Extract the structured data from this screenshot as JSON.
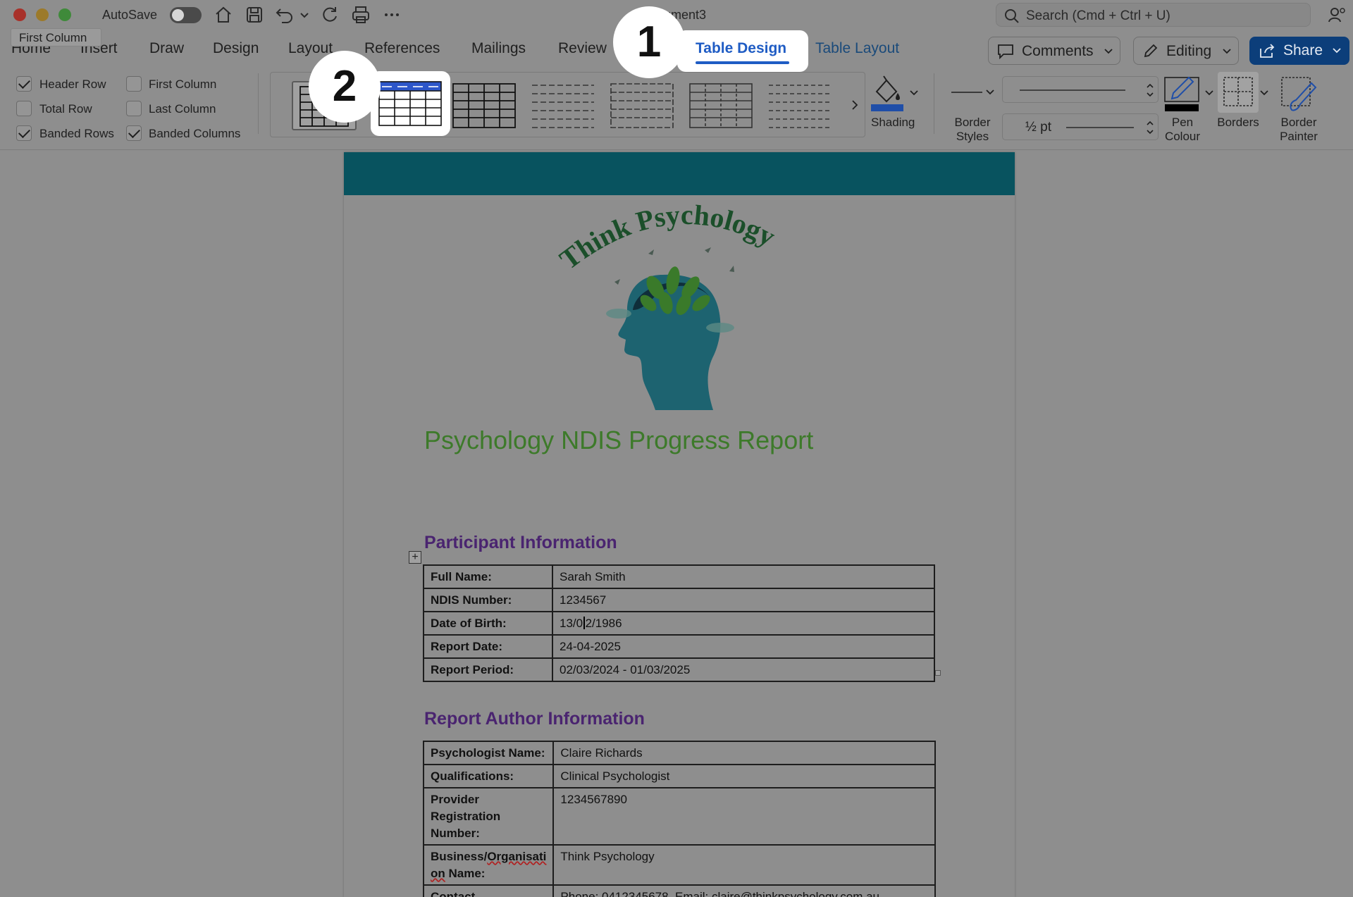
{
  "titlebar": {
    "autosave_label": "AutoSave",
    "doc_title": "Document3",
    "search_placeholder": "Search (Cmd + Ctrl + U)"
  },
  "tooltip": {
    "text": "First Column"
  },
  "tabs": [
    {
      "label": "Home"
    },
    {
      "label": "Insert"
    },
    {
      "label": "Draw"
    },
    {
      "label": "Design"
    },
    {
      "label": "Layout"
    },
    {
      "label": "References"
    },
    {
      "label": "Mailings"
    },
    {
      "label": "Review"
    }
  ],
  "active_tab": {
    "label": "Table Design"
  },
  "table_layout_tab": {
    "label": "Table Layout"
  },
  "actions": {
    "comments": "Comments",
    "editing": "Editing",
    "share": "Share"
  },
  "style_options": [
    {
      "label": "Header Row",
      "checked": true
    },
    {
      "label": "First Column",
      "checked": false
    },
    {
      "label": "Total Row",
      "checked": false
    },
    {
      "label": "Last Column",
      "checked": false
    },
    {
      "label": "Banded Rows",
      "checked": true
    },
    {
      "label": "Banded Columns",
      "checked": true
    }
  ],
  "ribbon": {
    "shading": "Shading",
    "border_styles": "Border Styles",
    "pen_weight": "½ pt",
    "pen_colour": "Pen Colour",
    "borders": "Borders",
    "border_painter": "Border Painter"
  },
  "callouts": {
    "step1": "1",
    "step2": "2"
  },
  "colors": {
    "header_band": "#08535f",
    "title_green": "#3d7a2a",
    "section_purple": "#4a2470",
    "accent_blue": "#1f5cc4",
    "share_blue": "#0c3e7a"
  },
  "document": {
    "logo_text": "Think Psychology",
    "title": "Psychology NDIS Progress Report",
    "participant_heading": "Participant Information",
    "participant_rows": [
      {
        "key": "Full Name:",
        "value": "Sarah Smith"
      },
      {
        "key": "NDIS Number:",
        "value": "1234567"
      },
      {
        "key": "Date of Birth:",
        "value_pre": "13/0",
        "value_post": "2/1986"
      },
      {
        "key": "Report Date:",
        "value": "24-04-2025"
      },
      {
        "key": "Report Period:",
        "value": "02/03/2024 - 01/03/2025"
      }
    ],
    "author_heading": "Report Author Information",
    "author_rows": [
      {
        "key": "Psychologist Name:",
        "value": "Claire Richards"
      },
      {
        "key": "Qualifications:",
        "value": "Clinical Psychologist"
      },
      {
        "key": "Provider Registration Number:",
        "value": "1234567890"
      },
      {
        "key_pre": "Business/",
        "key_squiggle": "Organisati on",
        "key_post": " Name:",
        "value": "Think Psychology"
      },
      {
        "key": "Contact",
        "value": "Phone: 0412345678, Email: claire@thinkpsychology.com.au"
      }
    ]
  }
}
